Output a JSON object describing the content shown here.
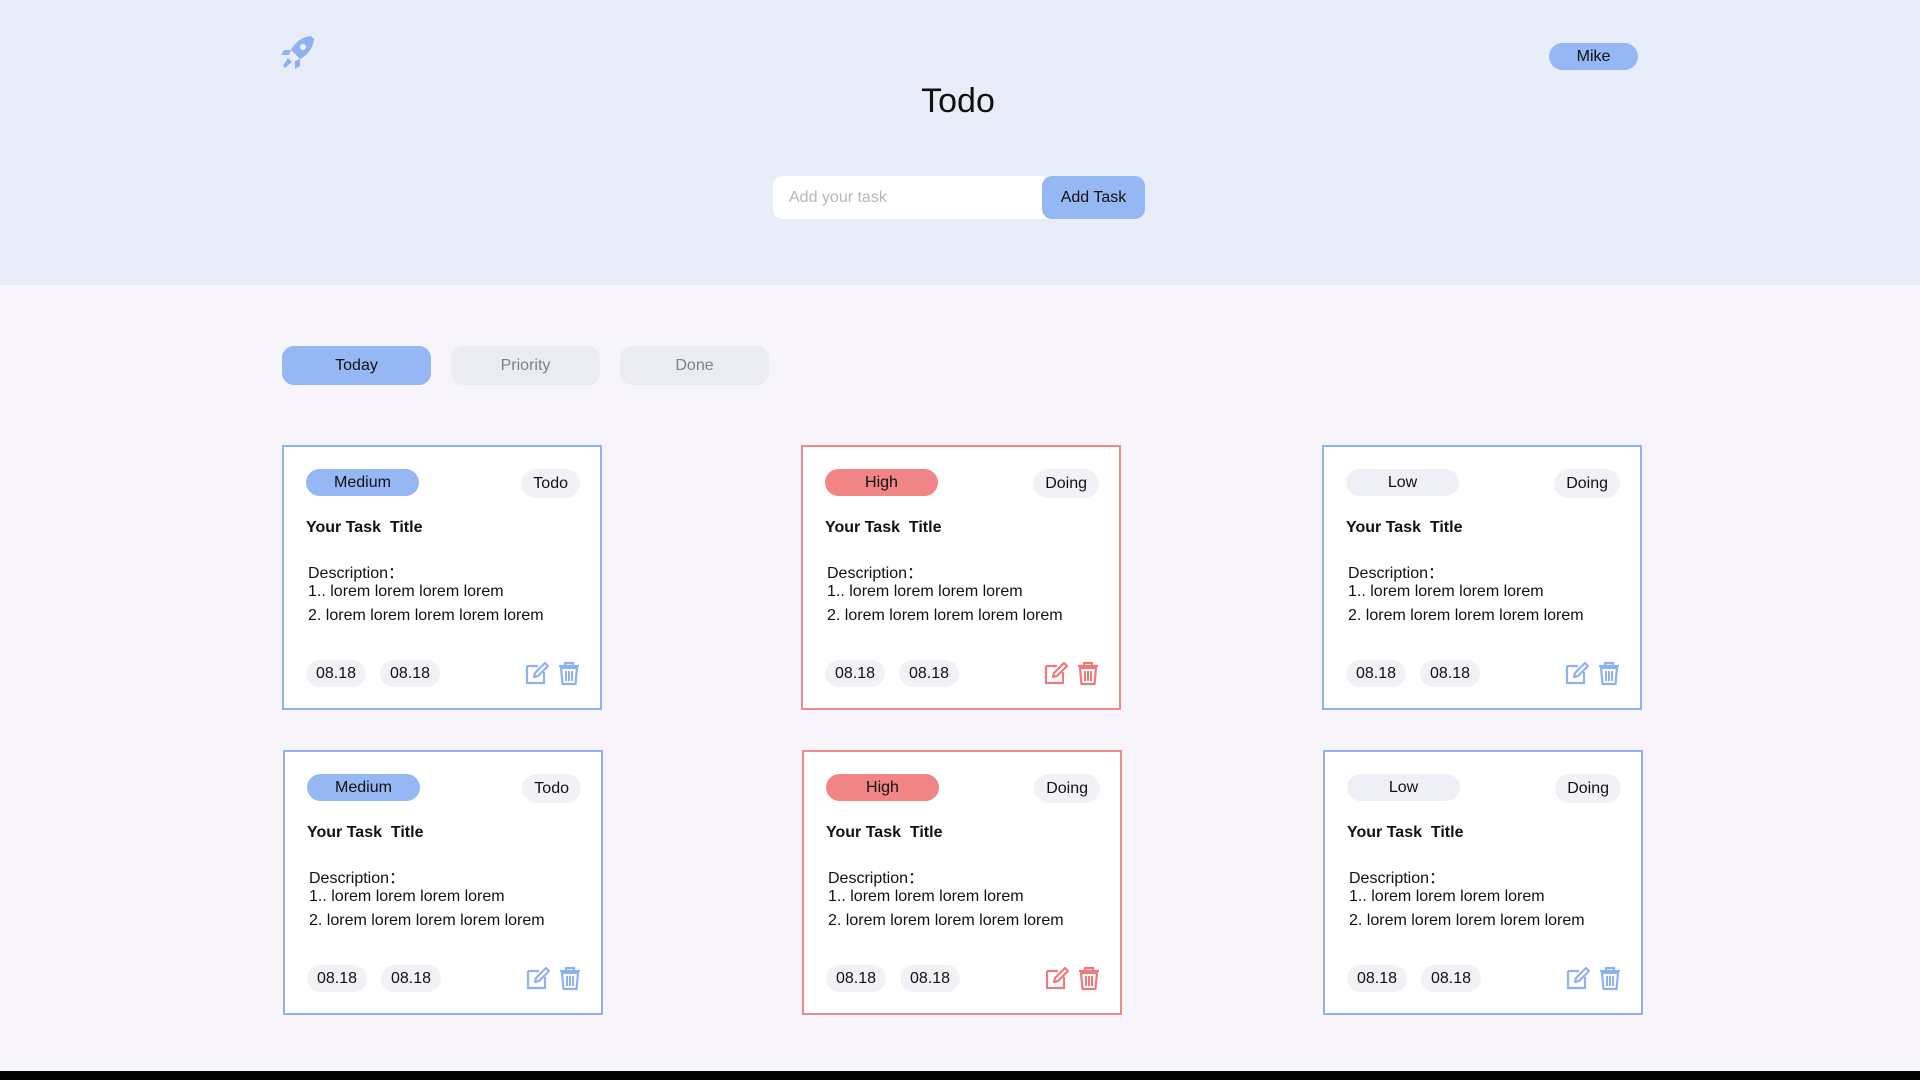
{
  "header": {
    "logo_icon": "rocket-icon",
    "title": "Todo",
    "user_name": "Mike",
    "add_task": {
      "placeholder": "Add your task",
      "button_label": "Add Task"
    }
  },
  "tabs": [
    {
      "label": "Today",
      "active": true
    },
    {
      "label": "Priority",
      "active": false
    },
    {
      "label": "Done",
      "active": false
    }
  ],
  "cards": [
    {
      "priority": "Medium",
      "status": "Todo",
      "title": "Your Task  Title",
      "description_label": "Description：",
      "lines": [
        "1.. lorem lorem lorem lorem",
        "2. lorem lorem lorem lorem lorem"
      ],
      "dates": [
        "08.18",
        "08.18"
      ],
      "edit_icon": "edit-icon",
      "delete_icon": "trash-icon"
    },
    {
      "priority": "High",
      "status": "Doing",
      "title": "Your Task  Title",
      "description_label": "Description：",
      "lines": [
        "1.. lorem lorem lorem lorem",
        "2. lorem lorem lorem lorem lorem"
      ],
      "dates": [
        "08.18",
        "08.18"
      ],
      "edit_icon": "edit-icon",
      "delete_icon": "trash-icon"
    },
    {
      "priority": "Low",
      "status": "Doing",
      "title": "Your Task  Title",
      "description_label": "Description：",
      "lines": [
        "1.. lorem lorem lorem lorem",
        "2. lorem lorem lorem lorem lorem"
      ],
      "dates": [
        "08.18",
        "08.18"
      ],
      "edit_icon": "edit-icon",
      "delete_icon": "trash-icon"
    },
    {
      "priority": "Medium",
      "status": "Todo",
      "title": "Your Task  Title",
      "description_label": "Description：",
      "lines": [
        "1.. lorem lorem lorem lorem",
        "2. lorem lorem lorem lorem lorem"
      ],
      "dates": [
        "08.18",
        "08.18"
      ],
      "edit_icon": "edit-icon",
      "delete_icon": "trash-icon"
    },
    {
      "priority": "High",
      "status": "Doing",
      "title": "Your Task  Title",
      "description_label": "Description：",
      "lines": [
        "1.. lorem lorem lorem lorem",
        "2. lorem lorem lorem lorem lorem"
      ],
      "dates": [
        "08.18",
        "08.18"
      ],
      "edit_icon": "edit-icon",
      "delete_icon": "trash-icon"
    },
    {
      "priority": "Low",
      "status": "Doing",
      "title": "Your Task  Title",
      "description_label": "Description：",
      "lines": [
        "1.. lorem lorem lorem lorem",
        "2. lorem lorem lorem lorem lorem"
      ],
      "dates": [
        "08.18",
        "08.18"
      ],
      "edit_icon": "edit-icon",
      "delete_icon": "trash-icon"
    }
  ],
  "colors": {
    "accent_blue": "#95b7f3",
    "high_red": "#f18585",
    "header_bg": "#e8edf9",
    "page_bg": "#f7f5fb"
  }
}
